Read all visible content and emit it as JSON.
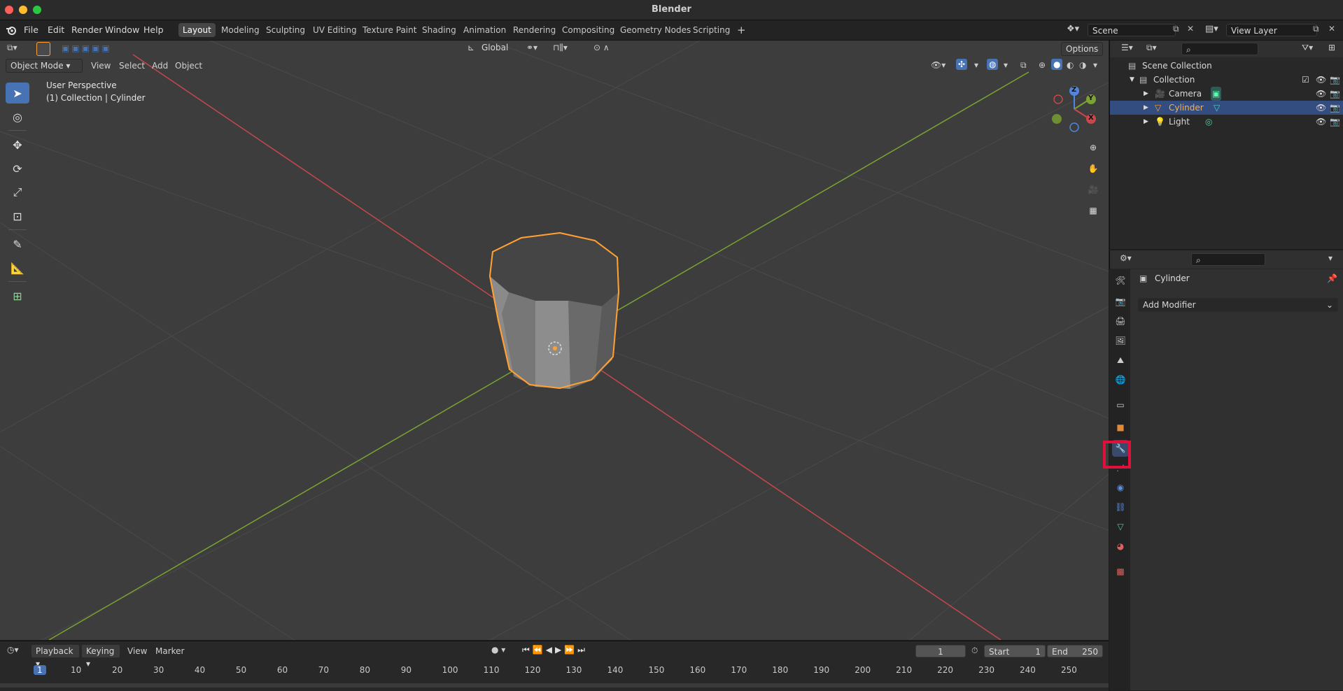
{
  "app": {
    "title": "Blender"
  },
  "menus": [
    "File",
    "Edit",
    "Render",
    "Window",
    "Help"
  ],
  "workspaces": [
    {
      "label": "Layout",
      "active": true
    },
    {
      "label": "Modeling"
    },
    {
      "label": "Sculpting"
    },
    {
      "label": "UV Editing"
    },
    {
      "label": "Texture Paint"
    },
    {
      "label": "Shading"
    },
    {
      "label": "Animation"
    },
    {
      "label": "Rendering"
    },
    {
      "label": "Compositing"
    },
    {
      "label": "Geometry Nodes"
    },
    {
      "label": "Scripting"
    }
  ],
  "scene": {
    "name": "Scene",
    "view_layer": "View Layer"
  },
  "viewport": {
    "mode": "Object Mode",
    "menus": [
      "View",
      "Select",
      "Add",
      "Object"
    ],
    "transform_orientation": "Global",
    "options_label": "Options",
    "overlay_title": "User Perspective",
    "overlay_subtitle": "(1) Collection | Cylinder",
    "axes": {
      "x": "X",
      "y": "Y",
      "z": "Z"
    }
  },
  "outliner": {
    "root": "Scene Collection",
    "collection": "Collection",
    "items": [
      {
        "label": "Camera",
        "selected": false
      },
      {
        "label": "Cylinder",
        "selected": true
      },
      {
        "label": "Light",
        "selected": false
      }
    ]
  },
  "properties": {
    "object_name": "Cylinder",
    "add_modifier": "Add Modifier",
    "active_tab": "modifier"
  },
  "timeline": {
    "menus": [
      "Playback",
      "Keying",
      "View",
      "Marker"
    ],
    "current_frame": "1",
    "start_label": "Start",
    "start": "1",
    "end_label": "End",
    "end": "250",
    "ticks": [
      "1",
      "10",
      "20",
      "30",
      "40",
      "50",
      "60",
      "70",
      "80",
      "90",
      "100",
      "110",
      "120",
      "130",
      "140",
      "150",
      "160",
      "170",
      "180",
      "190",
      "200",
      "210",
      "220",
      "230",
      "240",
      "250"
    ]
  },
  "colors": {
    "accent": "#4772b3",
    "selection_outline": "#ffa033",
    "highlight_box": "#e0103a",
    "x_axis": "#c8474b",
    "y_axis": "#7ba331"
  }
}
